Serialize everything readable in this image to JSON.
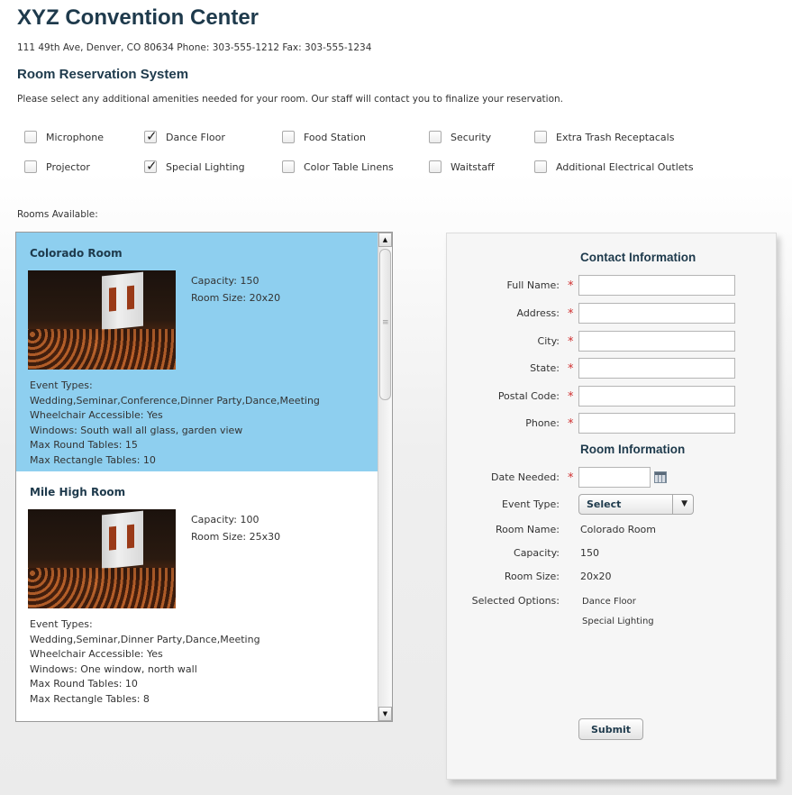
{
  "header": {
    "title": "XYZ Convention Center",
    "address": "111 49th Ave, Denver, CO  80634   Phone: 303-555-1212   Fax: 303-555-1234",
    "subtitle": "Room Reservation System",
    "instructions": "Please select any additional amenities needed for your room. Our staff will contact you to finalize your reservation."
  },
  "amenities": [
    {
      "label": "Microphone",
      "checked": false
    },
    {
      "label": "Dance Floor",
      "checked": true
    },
    {
      "label": "Food Station",
      "checked": false
    },
    {
      "label": "Security",
      "checked": false
    },
    {
      "label": "Extra Trash Receptacals",
      "checked": false
    },
    {
      "label": "Projector",
      "checked": false
    },
    {
      "label": "Special Lighting",
      "checked": true
    },
    {
      "label": "Color Table Linens",
      "checked": false
    },
    {
      "label": "Waitstaff",
      "checked": false
    },
    {
      "label": "Additional Electrical Outlets",
      "checked": false
    }
  ],
  "rooms_label": "Rooms Available:",
  "rooms": [
    {
      "name": "Colorado Room",
      "selected": true,
      "capacity": "Capacity: 150",
      "size": "Room Size: 20x20",
      "event_types_label": "Event Types:",
      "event_types": "Wedding,Seminar,Conference,Dinner Party,Dance,Meeting",
      "wheelchair": "Wheelchair Accessible: Yes",
      "windows": "Windows: South wall all glass, garden view",
      "round_tables": "Max Round Tables: 15",
      "rect_tables": "Max Rectangle Tables: 10"
    },
    {
      "name": "Mile High Room",
      "selected": false,
      "capacity": "Capacity: 100",
      "size": "Room Size: 25x30",
      "event_types_label": "Event Types:",
      "event_types": "Wedding,Seminar,Dinner Party,Dance,Meeting",
      "wheelchair": "Wheelchair Accessible: Yes",
      "windows": "Windows: One window, north wall",
      "round_tables": "Max Round Tables: 10",
      "rect_tables": "Max Rectangle Tables: 8"
    }
  ],
  "form": {
    "contact_title": "Contact Information",
    "fields": [
      {
        "label": "Full Name:",
        "value": ""
      },
      {
        "label": "Address:",
        "value": ""
      },
      {
        "label": "City:",
        "value": ""
      },
      {
        "label": "State:",
        "value": ""
      },
      {
        "label": "Postal Code:",
        "value": ""
      },
      {
        "label": "Phone:",
        "value": ""
      }
    ],
    "required_marker": "*",
    "room_title": "Room Information",
    "date_label": "Date Needed:",
    "date_value": "",
    "event_type_label": "Event Type:",
    "event_type_value": "Select",
    "room_name_label": "Room Name:",
    "room_name_value": "Colorado Room",
    "capacity_label": "Capacity:",
    "capacity_value": "150",
    "room_size_label": "Room Size:",
    "room_size_value": "20x20",
    "selected_options_label": "Selected Options:",
    "selected_options": [
      "Dance Floor",
      "Special Lighting"
    ],
    "submit_label": "Submit"
  },
  "icons": {
    "checkmark": "✓",
    "dropdown_arrow": "▼",
    "scroll_up": "▲",
    "scroll_down": "▼",
    "calendar": "calendar-icon"
  },
  "colors": {
    "title": "#1e3a4c",
    "selected_room_bg": "#8ecfef",
    "required": "#d03030"
  }
}
